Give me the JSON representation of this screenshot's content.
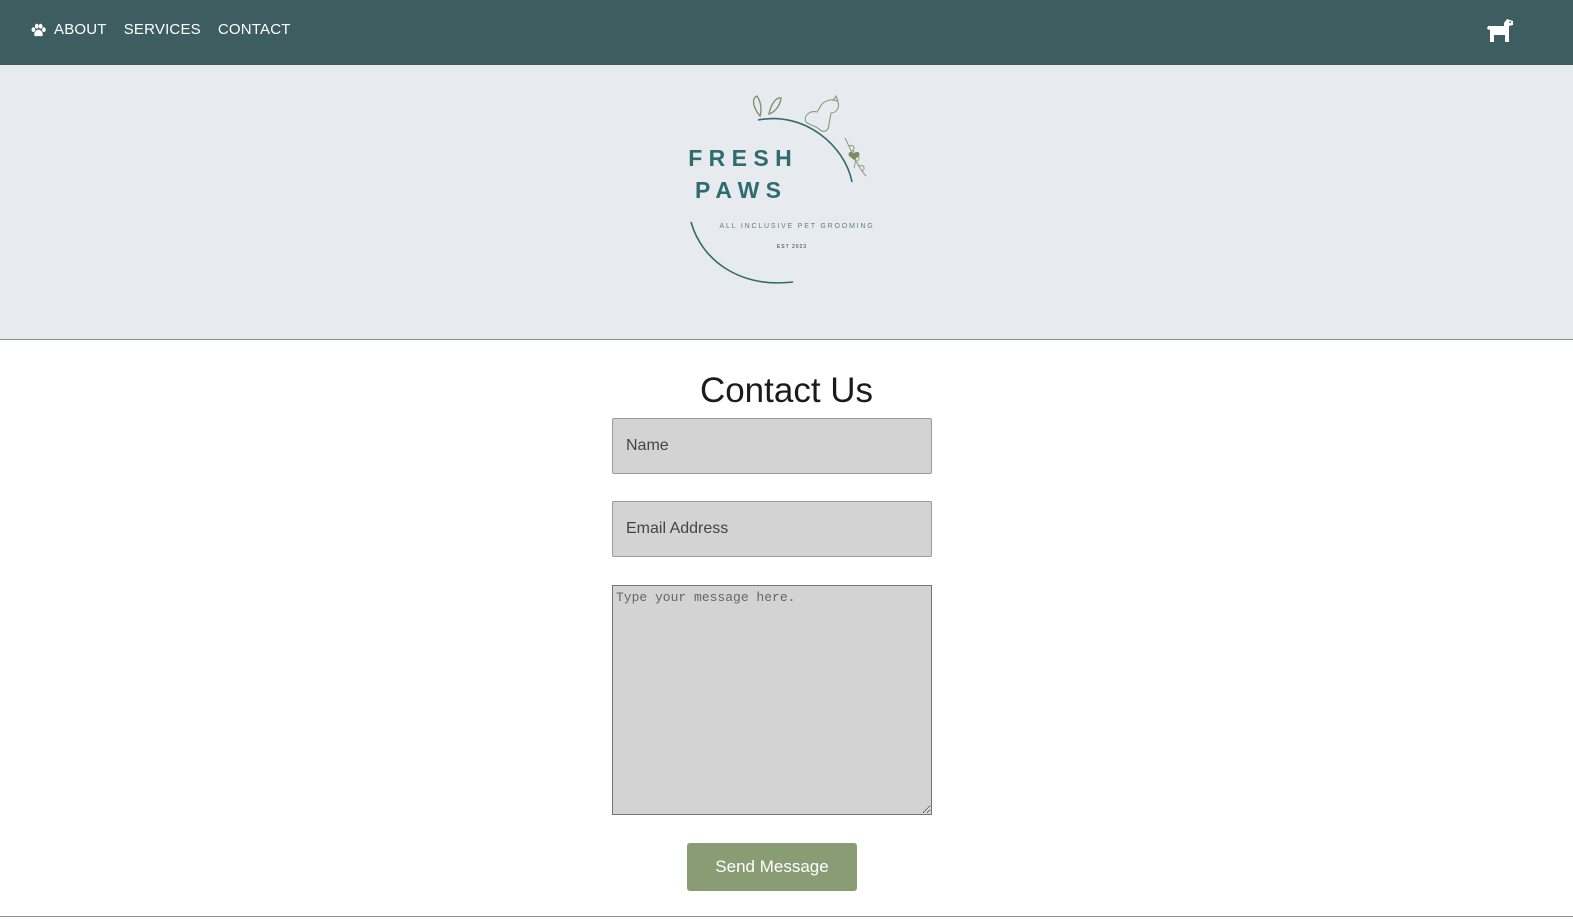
{
  "nav": {
    "items": [
      {
        "label": "ABOUT"
      },
      {
        "label": "SERVICES"
      },
      {
        "label": "CONTACT"
      }
    ],
    "paw_icon": "paw-icon",
    "cart_icon": "dog-icon"
  },
  "logo": {
    "line1": "F R E S H",
    "line2": "P A W S",
    "tagline": "ALL INCLUSIVE PET GROOMING",
    "established": "EST 2023",
    "colors": {
      "teal": "#2f6b6f",
      "sage": "#8a9c74"
    }
  },
  "contact": {
    "title": "Contact Us",
    "name_placeholder": "Name",
    "email_placeholder": "Email Address",
    "message_placeholder": "Type your message here.",
    "submit_label": "Send Message"
  },
  "colors": {
    "topbar": "#3e5d61",
    "hero": "#e7eaee",
    "button": "#8a9c74",
    "field": "#d3d3d3"
  }
}
